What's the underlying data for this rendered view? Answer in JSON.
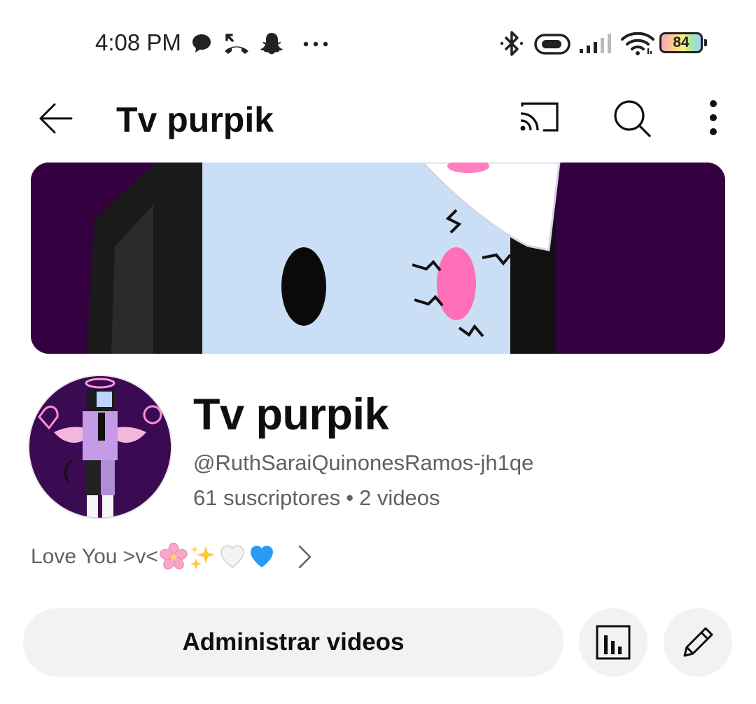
{
  "status_bar": {
    "time": "4:08 PM",
    "battery_level": "84",
    "left_icons": [
      "chat-bubble-icon",
      "missed-call-icon",
      "snapchat-ghost-icon",
      "more-dots-icon"
    ],
    "right_icons": [
      "bluetooth-icon",
      "toggle-icon",
      "signal-icon",
      "wifi-icon",
      "battery-icon"
    ]
  },
  "app_bar": {
    "title": "Tv purpik",
    "icons": [
      "back-arrow-icon",
      "cast-icon",
      "search-icon",
      "more-vert-icon"
    ]
  },
  "channel": {
    "name": "Tv purpik",
    "handle": "@RuthSaraiQuinonesRamos-jh1qe",
    "subscribers": "61 suscriptores",
    "separator": "•",
    "videos": "2 videos",
    "description": "Love You >v<",
    "description_emoji": [
      "cherry-blossom-emoji",
      "sparkles-emoji",
      "white-heart-emoji",
      "blue-heart-emoji"
    ]
  },
  "actions": {
    "manage_label": "Administrar videos",
    "icons": [
      "analytics-icon",
      "edit-pencil-icon"
    ]
  },
  "colors": {
    "banner_bg": "#35003f",
    "button_bg": "#f2f2f2",
    "secondary_text": "#606060"
  }
}
